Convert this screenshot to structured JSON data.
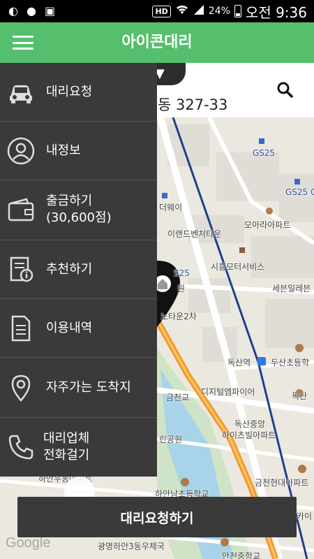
{
  "status_bar": {
    "hd_badge": "HD",
    "battery_text": "24%",
    "time": "오전 9:36"
  },
  "app_bar": {
    "title": "아이콘대리",
    "menu_icon": "hamburger-menu-icon"
  },
  "address_bar": {
    "region_suffix": "▼",
    "address": "동 327-33",
    "search_icon": "search-icon"
  },
  "drawer": {
    "items": [
      {
        "label": "대리요청",
        "sub": "",
        "icon": "car-icon"
      },
      {
        "label": "내정보",
        "sub": "",
        "icon": "user-icon"
      },
      {
        "label": "출금하기",
        "sub": "(30,600점)",
        "icon": "wallet-icon"
      },
      {
        "label": "추천하기",
        "sub": "",
        "icon": "recommend-icon"
      },
      {
        "label": "이용내역",
        "sub": "",
        "icon": "document-icon"
      },
      {
        "label": "자주가는 도착지",
        "sub": "",
        "icon": "location-pin-icon"
      },
      {
        "label": "대리업체",
        "sub": "전화걸기",
        "icon": "phone-icon"
      }
    ]
  },
  "map": {
    "labels": {
      "gs25_top": "GS25",
      "gs25_right": "GS25 G",
      "dreamway": "더웨이",
      "irand": "이랜드벤처타운",
      "moara": "모아라아파트",
      "siheung": "시흥모터서비스",
      "seven": "세븐일레븐",
      "gs25_mid": "S25",
      "won": "원",
      "notown": "노타운2차",
      "doksan_station": "독산역",
      "dusan_school": "두산초등학",
      "digital": "디지털엠파이어",
      "doksan": "독산",
      "geumcheon": "금천교",
      "doksan_jungang": "독산중앙",
      "heights": "하이츠빌아파트",
      "park": "린공원",
      "hyundai_apt": "금천현대아파트",
      "top_left": "하안우동아파트",
      "hanam": "하안남초등학교",
      "ka": "카이",
      "gwangmyeong": "광명하안3동우체국",
      "ancheon": "안천중학교"
    }
  },
  "request_button": "대리요청하기",
  "google": "Google"
}
